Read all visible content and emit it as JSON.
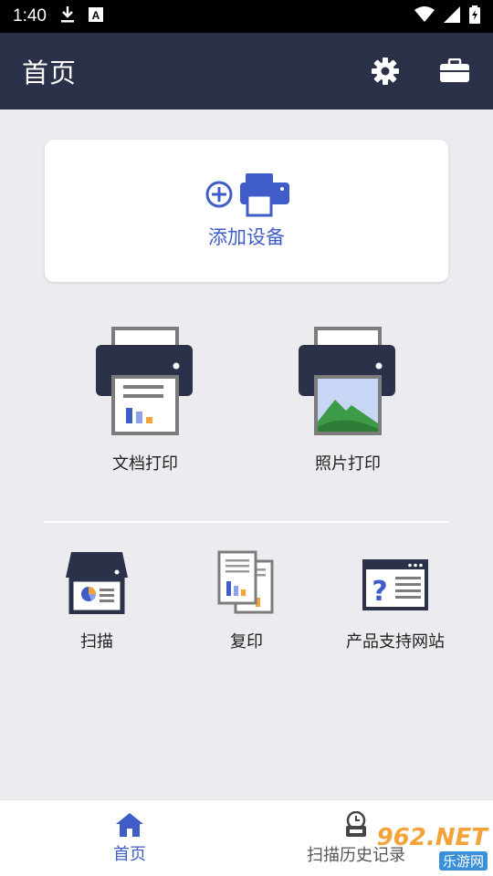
{
  "status_bar": {
    "time": "1:40",
    "icons": [
      "download-icon",
      "a-icon",
      "wifi-icon",
      "signal-icon",
      "battery-icon"
    ]
  },
  "app_bar": {
    "title": "首页",
    "actions": [
      "settings-icon",
      "toolbox-icon"
    ]
  },
  "add_device": {
    "label": "添加设备"
  },
  "primary_features": [
    {
      "label": "文档打印",
      "icon": "document-print-icon"
    },
    {
      "label": "照片打印",
      "icon": "photo-print-icon"
    }
  ],
  "secondary_features": [
    {
      "label": "扫描",
      "icon": "scan-icon"
    },
    {
      "label": "复印",
      "icon": "copy-icon"
    },
    {
      "label": "产品支持网站",
      "icon": "support-website-icon"
    }
  ],
  "bottom_nav": [
    {
      "label": "首页",
      "icon": "home-icon",
      "active": true
    },
    {
      "label": "扫描历史记录",
      "icon": "scan-history-icon",
      "active": false
    }
  ],
  "watermark": {
    "top": "962.NET",
    "bottom": "乐游网"
  },
  "colors": {
    "app_bar": "#2a3148",
    "accent": "#3f5cc8",
    "background": "#ececf0"
  }
}
